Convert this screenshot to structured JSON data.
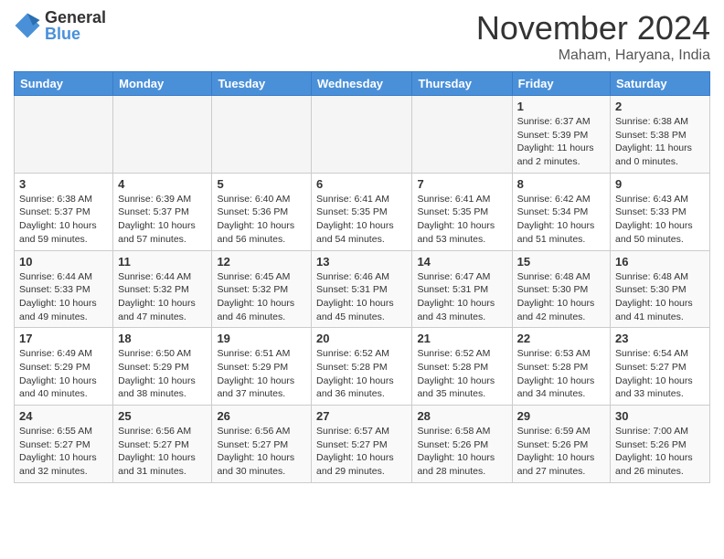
{
  "header": {
    "logo_general": "General",
    "logo_blue": "Blue",
    "month": "November 2024",
    "location": "Maham, Haryana, India"
  },
  "days_of_week": [
    "Sunday",
    "Monday",
    "Tuesday",
    "Wednesday",
    "Thursday",
    "Friday",
    "Saturday"
  ],
  "weeks": [
    [
      {
        "day": "",
        "info": ""
      },
      {
        "day": "",
        "info": ""
      },
      {
        "day": "",
        "info": ""
      },
      {
        "day": "",
        "info": ""
      },
      {
        "day": "",
        "info": ""
      },
      {
        "day": "1",
        "info": "Sunrise: 6:37 AM\nSunset: 5:39 PM\nDaylight: 11 hours and 2 minutes."
      },
      {
        "day": "2",
        "info": "Sunrise: 6:38 AM\nSunset: 5:38 PM\nDaylight: 11 hours and 0 minutes."
      }
    ],
    [
      {
        "day": "3",
        "info": "Sunrise: 6:38 AM\nSunset: 5:37 PM\nDaylight: 10 hours and 59 minutes."
      },
      {
        "day": "4",
        "info": "Sunrise: 6:39 AM\nSunset: 5:37 PM\nDaylight: 10 hours and 57 minutes."
      },
      {
        "day": "5",
        "info": "Sunrise: 6:40 AM\nSunset: 5:36 PM\nDaylight: 10 hours and 56 minutes."
      },
      {
        "day": "6",
        "info": "Sunrise: 6:41 AM\nSunset: 5:35 PM\nDaylight: 10 hours and 54 minutes."
      },
      {
        "day": "7",
        "info": "Sunrise: 6:41 AM\nSunset: 5:35 PM\nDaylight: 10 hours and 53 minutes."
      },
      {
        "day": "8",
        "info": "Sunrise: 6:42 AM\nSunset: 5:34 PM\nDaylight: 10 hours and 51 minutes."
      },
      {
        "day": "9",
        "info": "Sunrise: 6:43 AM\nSunset: 5:33 PM\nDaylight: 10 hours and 50 minutes."
      }
    ],
    [
      {
        "day": "10",
        "info": "Sunrise: 6:44 AM\nSunset: 5:33 PM\nDaylight: 10 hours and 49 minutes."
      },
      {
        "day": "11",
        "info": "Sunrise: 6:44 AM\nSunset: 5:32 PM\nDaylight: 10 hours and 47 minutes."
      },
      {
        "day": "12",
        "info": "Sunrise: 6:45 AM\nSunset: 5:32 PM\nDaylight: 10 hours and 46 minutes."
      },
      {
        "day": "13",
        "info": "Sunrise: 6:46 AM\nSunset: 5:31 PM\nDaylight: 10 hours and 45 minutes."
      },
      {
        "day": "14",
        "info": "Sunrise: 6:47 AM\nSunset: 5:31 PM\nDaylight: 10 hours and 43 minutes."
      },
      {
        "day": "15",
        "info": "Sunrise: 6:48 AM\nSunset: 5:30 PM\nDaylight: 10 hours and 42 minutes."
      },
      {
        "day": "16",
        "info": "Sunrise: 6:48 AM\nSunset: 5:30 PM\nDaylight: 10 hours and 41 minutes."
      }
    ],
    [
      {
        "day": "17",
        "info": "Sunrise: 6:49 AM\nSunset: 5:29 PM\nDaylight: 10 hours and 40 minutes."
      },
      {
        "day": "18",
        "info": "Sunrise: 6:50 AM\nSunset: 5:29 PM\nDaylight: 10 hours and 38 minutes."
      },
      {
        "day": "19",
        "info": "Sunrise: 6:51 AM\nSunset: 5:29 PM\nDaylight: 10 hours and 37 minutes."
      },
      {
        "day": "20",
        "info": "Sunrise: 6:52 AM\nSunset: 5:28 PM\nDaylight: 10 hours and 36 minutes."
      },
      {
        "day": "21",
        "info": "Sunrise: 6:52 AM\nSunset: 5:28 PM\nDaylight: 10 hours and 35 minutes."
      },
      {
        "day": "22",
        "info": "Sunrise: 6:53 AM\nSunset: 5:28 PM\nDaylight: 10 hours and 34 minutes."
      },
      {
        "day": "23",
        "info": "Sunrise: 6:54 AM\nSunset: 5:27 PM\nDaylight: 10 hours and 33 minutes."
      }
    ],
    [
      {
        "day": "24",
        "info": "Sunrise: 6:55 AM\nSunset: 5:27 PM\nDaylight: 10 hours and 32 minutes."
      },
      {
        "day": "25",
        "info": "Sunrise: 6:56 AM\nSunset: 5:27 PM\nDaylight: 10 hours and 31 minutes."
      },
      {
        "day": "26",
        "info": "Sunrise: 6:56 AM\nSunset: 5:27 PM\nDaylight: 10 hours and 30 minutes."
      },
      {
        "day": "27",
        "info": "Sunrise: 6:57 AM\nSunset: 5:27 PM\nDaylight: 10 hours and 29 minutes."
      },
      {
        "day": "28",
        "info": "Sunrise: 6:58 AM\nSunset: 5:26 PM\nDaylight: 10 hours and 28 minutes."
      },
      {
        "day": "29",
        "info": "Sunrise: 6:59 AM\nSunset: 5:26 PM\nDaylight: 10 hours and 27 minutes."
      },
      {
        "day": "30",
        "info": "Sunrise: 7:00 AM\nSunset: 5:26 PM\nDaylight: 10 hours and 26 minutes."
      }
    ]
  ]
}
